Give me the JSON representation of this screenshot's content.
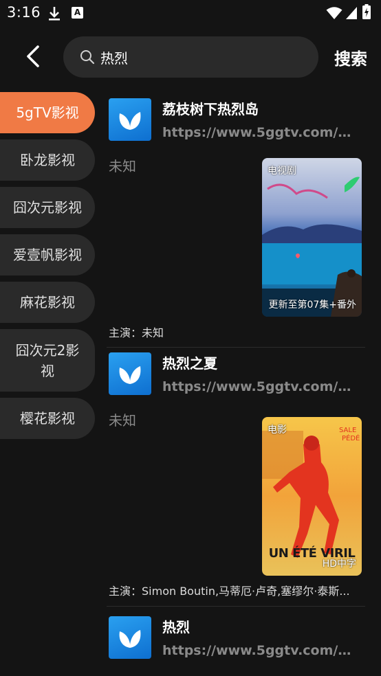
{
  "status_bar": {
    "time": "3:16",
    "icons": [
      "download-icon",
      "font-a-icon",
      "wifi-icon",
      "signal-icon",
      "battery-charging-icon"
    ],
    "a_glyph": "A"
  },
  "header": {
    "back_icon": "chevron-left-icon",
    "search_icon": "search-icon",
    "search_value": "热烈",
    "search_button": "搜索"
  },
  "sidebar": {
    "items": [
      {
        "label": "5gTV影视",
        "active": true
      },
      {
        "label": "卧龙影视",
        "active": false
      },
      {
        "label": "囧次元影视",
        "active": false
      },
      {
        "label": "爱壹帆影视",
        "active": false
      },
      {
        "label": "麻花影视",
        "active": false
      },
      {
        "label": "囧次元2影视",
        "active": false
      },
      {
        "label": "樱花影视",
        "active": false
      }
    ]
  },
  "results": [
    {
      "title": "荔枝树下热烈岛",
      "url": "https://www.5ggtv.com/vod/...",
      "status": "未知",
      "poster_type": "电视剧",
      "poster_badge": "更新至第07集+番外",
      "cast": "主演：未知"
    },
    {
      "title": "热烈之夏",
      "url": "https://www.5ggtv.com/vod/...",
      "status": "未知",
      "poster_type": "电影",
      "poster_badge": "HD中字",
      "poster_text": "UN ÉTÉ VIRIL",
      "cast": "主演：Simon Boutin,马蒂厄·卢奇,塞缪尔·泰斯..."
    },
    {
      "title": "热烈",
      "url": "https://www.5ggtv.com/vod/..."
    }
  ],
  "colors": {
    "accent": "#f07a45",
    "background": "#141414",
    "chip": "#2a2a2a",
    "muted_text": "#8a8a8a"
  }
}
